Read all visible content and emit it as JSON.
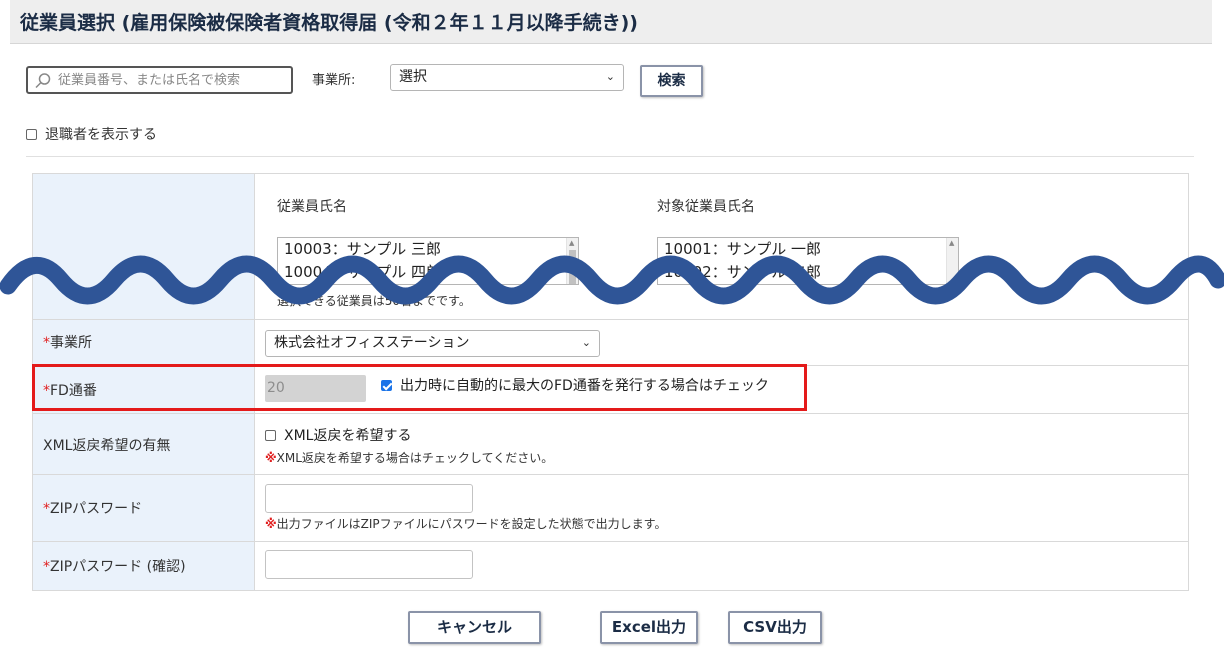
{
  "page": {
    "title": "従業員選択 (雇用保険被保険者資格取得届 (令和２年１１月以降手続き))"
  },
  "search": {
    "placeholder": "従業員番号、または氏名で検索",
    "office_label": "事業所:",
    "office_select_value": "選択",
    "search_button": "検索",
    "show_retired_label": "退職者を表示する",
    "show_retired_checked": false
  },
  "employee_select": {
    "left_header": "従業員氏名",
    "right_header": "対象従業員氏名",
    "left_items": [
      "10003：サンプル 三郎",
      "10004：サンプル 四郎"
    ],
    "right_items": [
      "10001：サンプル 一郎",
      "10002：サンプル 二郎"
    ],
    "limit_note": "選択できる従業員は50名までです。"
  },
  "fields": {
    "office": {
      "required_mark": "*",
      "label": "事業所",
      "value": "株式会社オフィスステーション"
    },
    "fd_number": {
      "required_mark": "*",
      "label": "FD通番",
      "value": "20",
      "auto_label": "出力時に自動的に最大のFD通番を発行する場合はチェック",
      "auto_checked": true
    },
    "xml_return": {
      "label": "XML返戻希望の有無",
      "option_label": "XML返戻を希望する",
      "checked": false,
      "note_mark": "※",
      "note": "XML返戻を希望する場合はチェックしてください。"
    },
    "zip_password": {
      "required_mark": "*",
      "label": "ZIPパスワード",
      "value": "",
      "note_mark": "※",
      "note": "出力ファイルはZIPファイルにパスワードを設定した状態で出力します。"
    },
    "zip_password_confirm": {
      "required_mark": "*",
      "label": "ZIPパスワード (確認)",
      "value": ""
    }
  },
  "buttons": {
    "cancel": "キャンセル",
    "excel": "Excel出力",
    "csv": "CSV出力"
  },
  "colors": {
    "required": "#e02020",
    "highlight": "#e41a1a",
    "wave": "#2f5597",
    "label_bg": "#eaf2fb",
    "title_text": "#1b2c45"
  }
}
